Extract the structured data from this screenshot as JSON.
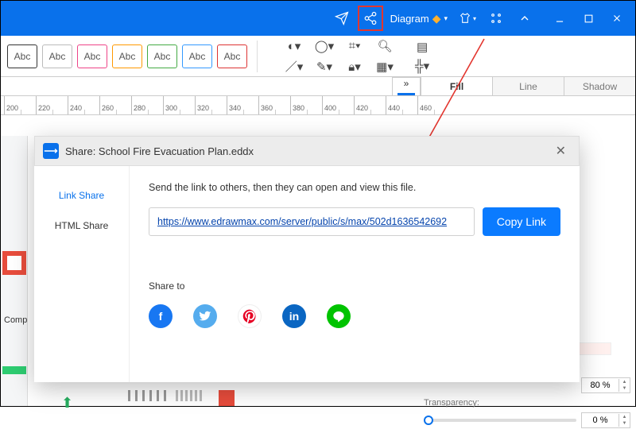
{
  "titlebar": {
    "diagram_label": "Diagram"
  },
  "swatches": [
    {
      "label": "Abc",
      "border": "#333"
    },
    {
      "label": "Abc",
      "border": "#bbb"
    },
    {
      "label": "Abc",
      "border": "#e48"
    },
    {
      "label": "Abc",
      "border": "#f90"
    },
    {
      "label": "Abc",
      "border": "#4a4"
    },
    {
      "label": "Abc",
      "border": "#39f"
    },
    {
      "label": "Abc",
      "border": "#d33"
    }
  ],
  "prop_tabs": {
    "fill": "Fill",
    "line": "Line",
    "shadow": "Shadow"
  },
  "ruler_ticks": [
    "200",
    "220",
    "240",
    "260",
    "280",
    "300",
    "320",
    "340",
    "360",
    "380",
    "400",
    "420",
    "440",
    "460"
  ],
  "right_panel": {
    "pct": "80 %",
    "transparency_label": "Transparency:",
    "trans_val": "0 %"
  },
  "canvas_hints": {
    "component": "Comp"
  },
  "dialog": {
    "title": "Share: School Fire Evacuation Plan.eddx",
    "nav_link": "Link Share",
    "nav_html": "HTML Share",
    "info": "Send the link to others, then they can open and view this file.",
    "url": "https://www.edrawmax.com/server/public/s/max/502d1636542692",
    "copy": "Copy Link",
    "share_to": "Share to"
  }
}
